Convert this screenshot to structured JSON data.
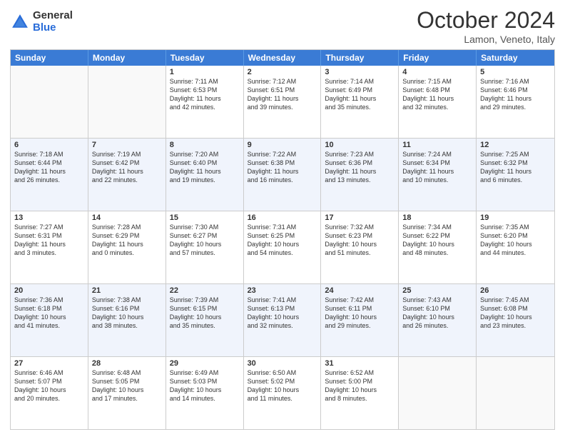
{
  "header": {
    "logo": {
      "general": "General",
      "blue": "Blue"
    },
    "title": "October 2024",
    "location": "Lamon, Veneto, Italy"
  },
  "days_of_week": [
    "Sunday",
    "Monday",
    "Tuesday",
    "Wednesday",
    "Thursday",
    "Friday",
    "Saturday"
  ],
  "weeks": [
    {
      "alt": false,
      "cells": [
        {
          "day": "",
          "empty": true,
          "lines": []
        },
        {
          "day": "",
          "empty": true,
          "lines": []
        },
        {
          "day": "1",
          "empty": false,
          "lines": [
            "Sunrise: 7:11 AM",
            "Sunset: 6:53 PM",
            "Daylight: 11 hours",
            "and 42 minutes."
          ]
        },
        {
          "day": "2",
          "empty": false,
          "lines": [
            "Sunrise: 7:12 AM",
            "Sunset: 6:51 PM",
            "Daylight: 11 hours",
            "and 39 minutes."
          ]
        },
        {
          "day": "3",
          "empty": false,
          "lines": [
            "Sunrise: 7:14 AM",
            "Sunset: 6:49 PM",
            "Daylight: 11 hours",
            "and 35 minutes."
          ]
        },
        {
          "day": "4",
          "empty": false,
          "lines": [
            "Sunrise: 7:15 AM",
            "Sunset: 6:48 PM",
            "Daylight: 11 hours",
            "and 32 minutes."
          ]
        },
        {
          "day": "5",
          "empty": false,
          "lines": [
            "Sunrise: 7:16 AM",
            "Sunset: 6:46 PM",
            "Daylight: 11 hours",
            "and 29 minutes."
          ]
        }
      ]
    },
    {
      "alt": true,
      "cells": [
        {
          "day": "6",
          "empty": false,
          "lines": [
            "Sunrise: 7:18 AM",
            "Sunset: 6:44 PM",
            "Daylight: 11 hours",
            "and 26 minutes."
          ]
        },
        {
          "day": "7",
          "empty": false,
          "lines": [
            "Sunrise: 7:19 AM",
            "Sunset: 6:42 PM",
            "Daylight: 11 hours",
            "and 22 minutes."
          ]
        },
        {
          "day": "8",
          "empty": false,
          "lines": [
            "Sunrise: 7:20 AM",
            "Sunset: 6:40 PM",
            "Daylight: 11 hours",
            "and 19 minutes."
          ]
        },
        {
          "day": "9",
          "empty": false,
          "lines": [
            "Sunrise: 7:22 AM",
            "Sunset: 6:38 PM",
            "Daylight: 11 hours",
            "and 16 minutes."
          ]
        },
        {
          "day": "10",
          "empty": false,
          "lines": [
            "Sunrise: 7:23 AM",
            "Sunset: 6:36 PM",
            "Daylight: 11 hours",
            "and 13 minutes."
          ]
        },
        {
          "day": "11",
          "empty": false,
          "lines": [
            "Sunrise: 7:24 AM",
            "Sunset: 6:34 PM",
            "Daylight: 11 hours",
            "and 10 minutes."
          ]
        },
        {
          "day": "12",
          "empty": false,
          "lines": [
            "Sunrise: 7:25 AM",
            "Sunset: 6:32 PM",
            "Daylight: 11 hours",
            "and 6 minutes."
          ]
        }
      ]
    },
    {
      "alt": false,
      "cells": [
        {
          "day": "13",
          "empty": false,
          "lines": [
            "Sunrise: 7:27 AM",
            "Sunset: 6:31 PM",
            "Daylight: 11 hours",
            "and 3 minutes."
          ]
        },
        {
          "day": "14",
          "empty": false,
          "lines": [
            "Sunrise: 7:28 AM",
            "Sunset: 6:29 PM",
            "Daylight: 11 hours",
            "and 0 minutes."
          ]
        },
        {
          "day": "15",
          "empty": false,
          "lines": [
            "Sunrise: 7:30 AM",
            "Sunset: 6:27 PM",
            "Daylight: 10 hours",
            "and 57 minutes."
          ]
        },
        {
          "day": "16",
          "empty": false,
          "lines": [
            "Sunrise: 7:31 AM",
            "Sunset: 6:25 PM",
            "Daylight: 10 hours",
            "and 54 minutes."
          ]
        },
        {
          "day": "17",
          "empty": false,
          "lines": [
            "Sunrise: 7:32 AM",
            "Sunset: 6:23 PM",
            "Daylight: 10 hours",
            "and 51 minutes."
          ]
        },
        {
          "day": "18",
          "empty": false,
          "lines": [
            "Sunrise: 7:34 AM",
            "Sunset: 6:22 PM",
            "Daylight: 10 hours",
            "and 48 minutes."
          ]
        },
        {
          "day": "19",
          "empty": false,
          "lines": [
            "Sunrise: 7:35 AM",
            "Sunset: 6:20 PM",
            "Daylight: 10 hours",
            "and 44 minutes."
          ]
        }
      ]
    },
    {
      "alt": true,
      "cells": [
        {
          "day": "20",
          "empty": false,
          "lines": [
            "Sunrise: 7:36 AM",
            "Sunset: 6:18 PM",
            "Daylight: 10 hours",
            "and 41 minutes."
          ]
        },
        {
          "day": "21",
          "empty": false,
          "lines": [
            "Sunrise: 7:38 AM",
            "Sunset: 6:16 PM",
            "Daylight: 10 hours",
            "and 38 minutes."
          ]
        },
        {
          "day": "22",
          "empty": false,
          "lines": [
            "Sunrise: 7:39 AM",
            "Sunset: 6:15 PM",
            "Daylight: 10 hours",
            "and 35 minutes."
          ]
        },
        {
          "day": "23",
          "empty": false,
          "lines": [
            "Sunrise: 7:41 AM",
            "Sunset: 6:13 PM",
            "Daylight: 10 hours",
            "and 32 minutes."
          ]
        },
        {
          "day": "24",
          "empty": false,
          "lines": [
            "Sunrise: 7:42 AM",
            "Sunset: 6:11 PM",
            "Daylight: 10 hours",
            "and 29 minutes."
          ]
        },
        {
          "day": "25",
          "empty": false,
          "lines": [
            "Sunrise: 7:43 AM",
            "Sunset: 6:10 PM",
            "Daylight: 10 hours",
            "and 26 minutes."
          ]
        },
        {
          "day": "26",
          "empty": false,
          "lines": [
            "Sunrise: 7:45 AM",
            "Sunset: 6:08 PM",
            "Daylight: 10 hours",
            "and 23 minutes."
          ]
        }
      ]
    },
    {
      "alt": false,
      "cells": [
        {
          "day": "27",
          "empty": false,
          "lines": [
            "Sunrise: 6:46 AM",
            "Sunset: 5:07 PM",
            "Daylight: 10 hours",
            "and 20 minutes."
          ]
        },
        {
          "day": "28",
          "empty": false,
          "lines": [
            "Sunrise: 6:48 AM",
            "Sunset: 5:05 PM",
            "Daylight: 10 hours",
            "and 17 minutes."
          ]
        },
        {
          "day": "29",
          "empty": false,
          "lines": [
            "Sunrise: 6:49 AM",
            "Sunset: 5:03 PM",
            "Daylight: 10 hours",
            "and 14 minutes."
          ]
        },
        {
          "day": "30",
          "empty": false,
          "lines": [
            "Sunrise: 6:50 AM",
            "Sunset: 5:02 PM",
            "Daylight: 10 hours",
            "and 11 minutes."
          ]
        },
        {
          "day": "31",
          "empty": false,
          "lines": [
            "Sunrise: 6:52 AM",
            "Sunset: 5:00 PM",
            "Daylight: 10 hours",
            "and 8 minutes."
          ]
        },
        {
          "day": "",
          "empty": true,
          "lines": []
        },
        {
          "day": "",
          "empty": true,
          "lines": []
        }
      ]
    }
  ]
}
